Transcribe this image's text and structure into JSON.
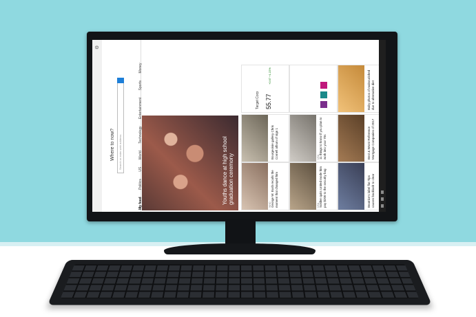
{
  "browser": {
    "search_prompt": "Where to now?",
    "search_placeholder": "Search or enter web address"
  },
  "feed_tabs": [
    "My feed",
    "Politics",
    "US",
    "World",
    "Technology",
    "Entertainment",
    "Sports",
    "Money"
  ],
  "hero": {
    "title": "Youths dance at high school graduation ceremony"
  },
  "stocks": {
    "name": "Target Corp",
    "value": "55.77",
    "change": "+0.67 +1.22%"
  },
  "cards": [
    {
      "title": "George W. Bush recalls the moment that changed him",
      "source": "WHO"
    },
    {
      "title": "Soldier quits United mode him pay $200 to the security bag",
      "source": "USA"
    },
    {
      "title": "Beatrice's label flat Tips causes backlash to clear",
      "source": ""
    },
    {
      "title": "Bourgeoisie gallery Chris Cornell album of sign 1",
      "source": ""
    },
    {
      "title": "11 things to know if you plan to work into your 70s",
      "source": "USA"
    },
    {
      "title": "Best & Worst Reference Mortgage Companies of 2017",
      "source": ""
    },
    {
      "title": "Baby photos of malnourished due to alternative diet",
      "source": ""
    }
  ],
  "colors": {
    "screen_bg": "#f4f4f4",
    "accent": "#1e7fd8",
    "sports_tile": "#7a2e8c",
    "wall": "#8fd9e0"
  }
}
